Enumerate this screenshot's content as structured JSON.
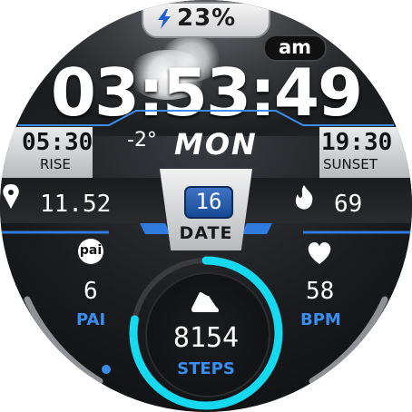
{
  "status": {
    "battery": "23%",
    "ampm": "am"
  },
  "clock": {
    "time": "03:53:49",
    "temperature": "-2°",
    "day": "MON"
  },
  "sunrise": {
    "time": "05:30",
    "label": "RISE"
  },
  "sunset": {
    "time": "19:30",
    "label": "SUNSET"
  },
  "distance": {
    "value": "11.52"
  },
  "calories": {
    "value": "69"
  },
  "date": {
    "day": "16",
    "label": "DATE"
  },
  "pai": {
    "badge": "pai",
    "value": "6",
    "label": "PAI"
  },
  "heart": {
    "value": "58",
    "label": "BPM"
  },
  "steps": {
    "value": "8154",
    "label": "STEPS",
    "progress": 0.78
  },
  "colors": {
    "accent": "#3a8ef0",
    "ring": "#16d9f0"
  },
  "icons": [
    "lightning-icon",
    "location-pin-icon",
    "flame-icon",
    "heart-icon",
    "shoe-icon"
  ]
}
